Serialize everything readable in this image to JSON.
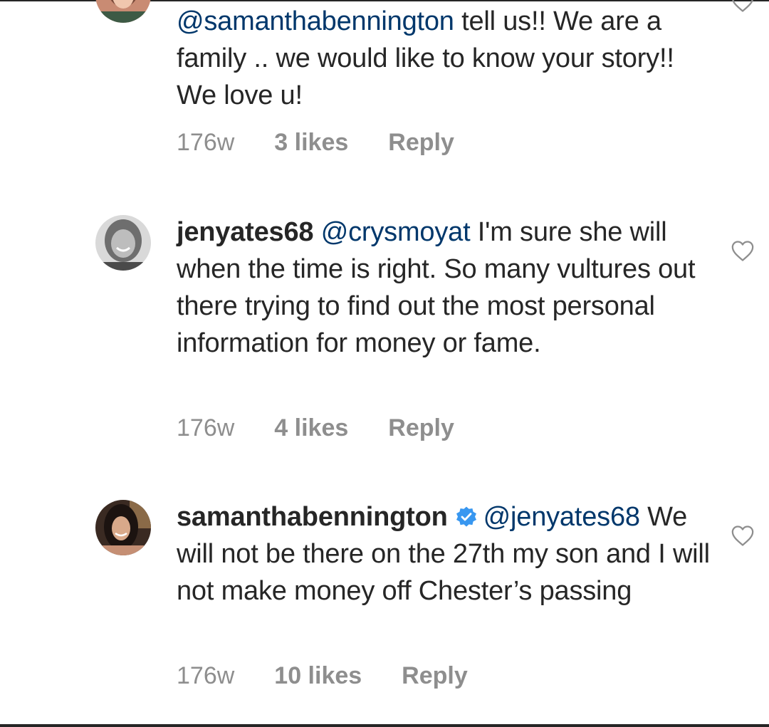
{
  "comments": [
    {
      "mention": "@samanthabennington",
      "text": " tell us!! We are a family .. we would like to know your story!! We love u!",
      "time": "176w",
      "likes": "3 likes",
      "reply": "Reply",
      "avatar_icon": "avatar-photo",
      "like_icon": "heart-outline-icon"
    },
    {
      "username": "jenyates68",
      "mention": "@crysmoyat",
      "text": " I'm sure she will when the time is right. So many vultures out there trying to find out the most personal information for money or fame.",
      "time": "176w",
      "likes": "4 likes",
      "reply": "Reply",
      "avatar_icon": "avatar-photo",
      "like_icon": "heart-outline-icon"
    },
    {
      "username": "samanthabennington",
      "verified": true,
      "mention": "@jenyates68",
      "text": " We will not be there on the 27th my son and I will not make money off Chester’s passing",
      "time": "176w",
      "likes": "10 likes",
      "reply": "Reply",
      "avatar_icon": "avatar-photo",
      "like_icon": "heart-outline-icon"
    }
  ],
  "colors": {
    "text": "#262626",
    "mention": "#00376b",
    "meta": "#8e8e8e",
    "verified": "#3897f0"
  }
}
